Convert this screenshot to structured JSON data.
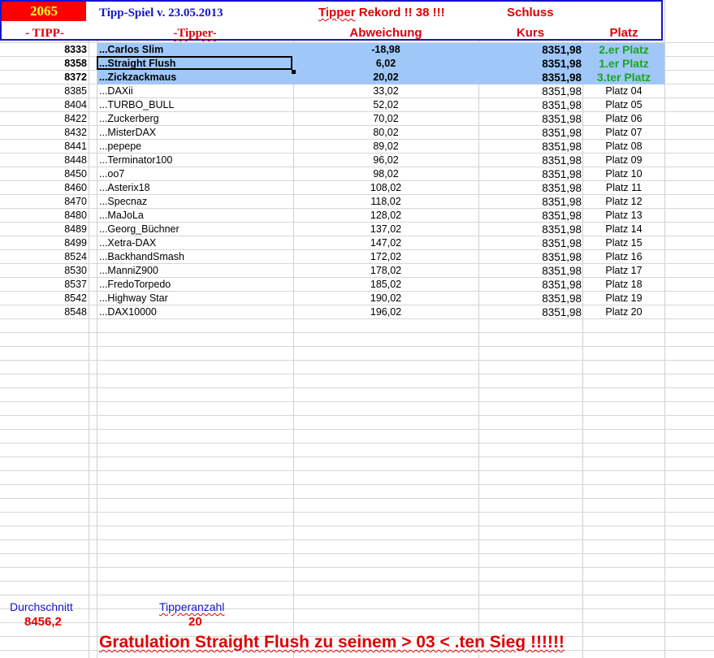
{
  "header": {
    "year": "2065",
    "title": "Tipp-Spiel v. 23.05.2013",
    "record_prefix": "Tipper",
    "record_suffix": " Rekord !!  38  !!!",
    "schluss": "Schluss",
    "col_tipp": "- TIPP-",
    "col_tipper": "-Tipper-",
    "col_abweichung": "Abweichung",
    "col_kurs": "Kurs",
    "col_platz": "Platz"
  },
  "rows": [
    {
      "tipp": "8333",
      "name": "...Carlos Slim",
      "abw": "-18,98",
      "kurs": "8351,98",
      "platz": "2.er Platz"
    },
    {
      "tipp": "8358",
      "name": "...Straight Flush",
      "abw": "6,02",
      "kurs": "8351,98",
      "platz": "1.er Platz"
    },
    {
      "tipp": "8372",
      "name": "...Zickzackmaus",
      "abw": "20,02",
      "kurs": "8351,98",
      "platz": "3.ter Platz"
    },
    {
      "tipp": "8385",
      "name": "...DAXii",
      "abw": "33,02",
      "kurs": "8351,98",
      "platz": "Platz 04"
    },
    {
      "tipp": "8404",
      "name": "...TURBO_BULL",
      "abw": "52,02",
      "kurs": "8351,98",
      "platz": "Platz 05"
    },
    {
      "tipp": "8422",
      "name": "...Zuckerberg",
      "abw": "70,02",
      "kurs": "8351,98",
      "platz": "Platz 06"
    },
    {
      "tipp": "8432",
      "name": "...MisterDAX",
      "abw": "80,02",
      "kurs": "8351,98",
      "platz": "Platz 07"
    },
    {
      "tipp": "8441",
      "name": "...pepepe",
      "abw": "89,02",
      "kurs": "8351,98",
      "platz": "Platz 08"
    },
    {
      "tipp": "8448",
      "name": "...Terminator100",
      "abw": "96,02",
      "kurs": "8351,98",
      "platz": "Platz 09"
    },
    {
      "tipp": "8450",
      "name": "...oo7",
      "abw": "98,02",
      "kurs": "8351,98",
      "platz": "Platz 10"
    },
    {
      "tipp": "8460",
      "name": "...Asterix18",
      "abw": "108,02",
      "kurs": "8351,98",
      "platz": "Platz 11"
    },
    {
      "tipp": "8470",
      "name": "...Specnaz",
      "abw": "118,02",
      "kurs": "8351,98",
      "platz": "Platz 12"
    },
    {
      "tipp": "8480",
      "name": "...MaJoLa",
      "abw": "128,02",
      "kurs": "8351,98",
      "platz": "Platz 13"
    },
    {
      "tipp": "8489",
      "name": "...Georg_Büchner",
      "abw": "137,02",
      "kurs": "8351,98",
      "platz": "Platz 14"
    },
    {
      "tipp": "8499",
      "name": "...Xetra-DAX",
      "abw": "147,02",
      "kurs": "8351,98",
      "platz": "Platz 15"
    },
    {
      "tipp": "8524",
      "name": "...BackhandSmash",
      "abw": "172,02",
      "kurs": "8351,98",
      "platz": "Platz 16"
    },
    {
      "tipp": "8530",
      "name": "...ManniZ900",
      "abw": "178,02",
      "kurs": "8351,98",
      "platz": "Platz 17"
    },
    {
      "tipp": "8537",
      "name": "...FredoTorpedo",
      "abw": "185,02",
      "kurs": "8351,98",
      "platz": "Platz 18"
    },
    {
      "tipp": "8542",
      "name": "...Highway Star",
      "abw": "190,02",
      "kurs": "8351,98",
      "platz": "Platz 19"
    },
    {
      "tipp": "8548",
      "name": "...DAX10000",
      "abw": "196,02",
      "kurs": "8351,98",
      "platz": "Platz 20"
    }
  ],
  "footer": {
    "avg_label": "Durchschnitt",
    "avg_value": "8456,2",
    "count_label": "Tipperanzahl",
    "count_value": "20",
    "congrats": "Gratulation Straight Flush zu seinem > 03 < .ten Sieg !!!!!!"
  },
  "colors": {
    "header_border": "#1515c8",
    "year_bg": "#ff0000",
    "year_text": "#ffff33",
    "red_text": "#e00000",
    "highlight": "#9fc8f8",
    "podium_green": "#1aa61a"
  }
}
